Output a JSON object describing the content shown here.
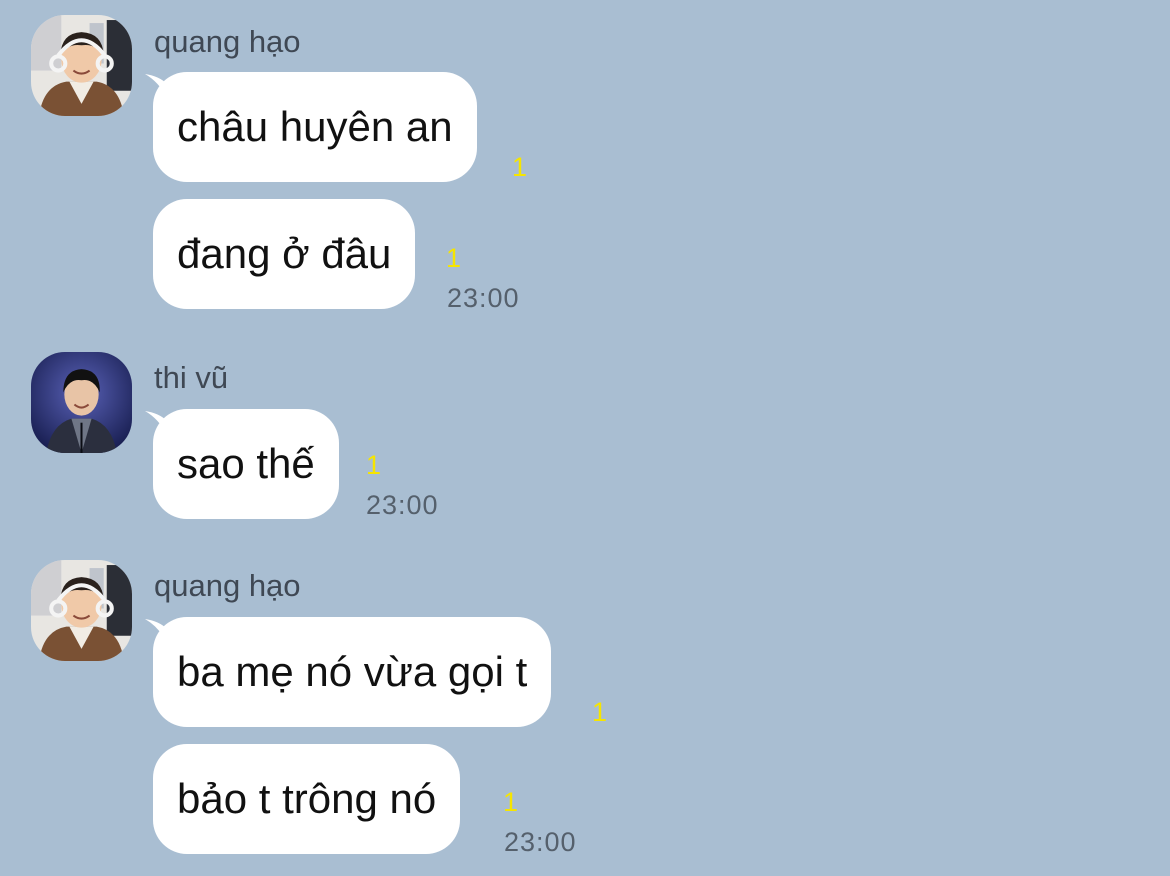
{
  "messages": [
    {
      "sender": "quang hạo",
      "avatar_icon": "user-avatar-icon",
      "bubbles": [
        {
          "text": "châu huyên an",
          "unread": "1",
          "time": ""
        },
        {
          "text": "đang ở đâu",
          "unread": "1",
          "time": "23:00"
        }
      ]
    },
    {
      "sender": "thi vũ",
      "avatar_icon": "user-avatar-icon",
      "bubbles": [
        {
          "text": "sao thế",
          "unread": "1",
          "time": "23:00"
        }
      ]
    },
    {
      "sender": "quang hạo",
      "avatar_icon": "user-avatar-icon",
      "bubbles": [
        {
          "text": "ba mẹ nó vừa gọi t",
          "unread": "1",
          "time": ""
        },
        {
          "text": "bảo t trông nó",
          "unread": "1",
          "time": "23:00"
        }
      ]
    }
  ],
  "colors": {
    "background": "#a9bed2",
    "bubble": "#ffffff",
    "unread": "#f6e500",
    "time": "#55606c",
    "sender": "#3f4854"
  }
}
